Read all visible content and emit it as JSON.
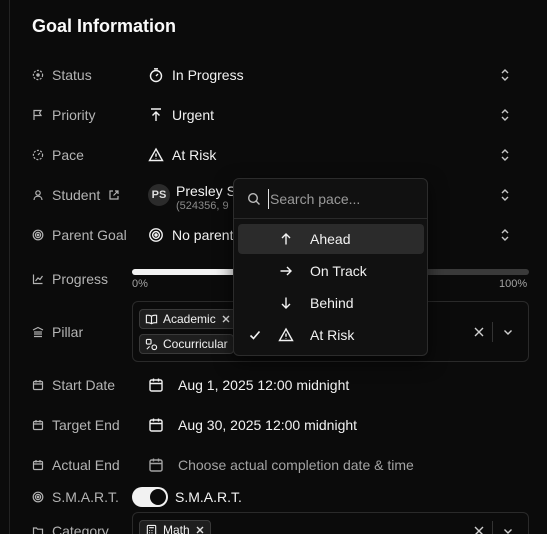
{
  "section_title": "Goal Information",
  "fields": {
    "status": {
      "label": "Status",
      "value": "In Progress"
    },
    "priority": {
      "label": "Priority",
      "value": "Urgent"
    },
    "pace": {
      "label": "Pace",
      "value": "At Risk"
    },
    "student": {
      "label": "Student",
      "name": "Presley S",
      "sub": "(524356, 9",
      "initials": "PS"
    },
    "parent_goal": {
      "label": "Parent Goal",
      "value": "No parent"
    },
    "progress": {
      "label": "Progress",
      "value_percent": 0,
      "min_label": "0%",
      "max_label": "100%"
    },
    "pillar": {
      "label": "Pillar",
      "chips": [
        "Academic",
        "Cocurricular"
      ]
    },
    "start_date": {
      "label": "Start Date",
      "value": "Aug 1, 2025 12:00 midnight"
    },
    "target_end": {
      "label": "Target End",
      "value": "Aug 30, 2025 12:00 midnight"
    },
    "actual_end": {
      "label": "Actual End",
      "placeholder": "Choose actual completion date & time"
    },
    "smart": {
      "label": "S.M.A.R.T.",
      "toggle_label": "S.M.A.R.T.",
      "enabled": true
    },
    "category": {
      "label": "Category",
      "chips": [
        "Math"
      ]
    }
  },
  "pace_dropdown": {
    "search_placeholder": "Search pace...",
    "options": [
      {
        "label": "Ahead",
        "icon": "arrow-up-icon",
        "highlighted": true,
        "selected": false
      },
      {
        "label": "On Track",
        "icon": "arrow-right-icon",
        "highlighted": false,
        "selected": false
      },
      {
        "label": "Behind",
        "icon": "arrow-down-icon",
        "highlighted": false,
        "selected": false
      },
      {
        "label": "At Risk",
        "icon": "warning-icon",
        "highlighted": false,
        "selected": true
      }
    ]
  },
  "colors": {
    "background": "#0b0b0b",
    "text": "#f2f2f2",
    "muted": "#b4b4b4",
    "highlight": "#2b2b2b"
  }
}
